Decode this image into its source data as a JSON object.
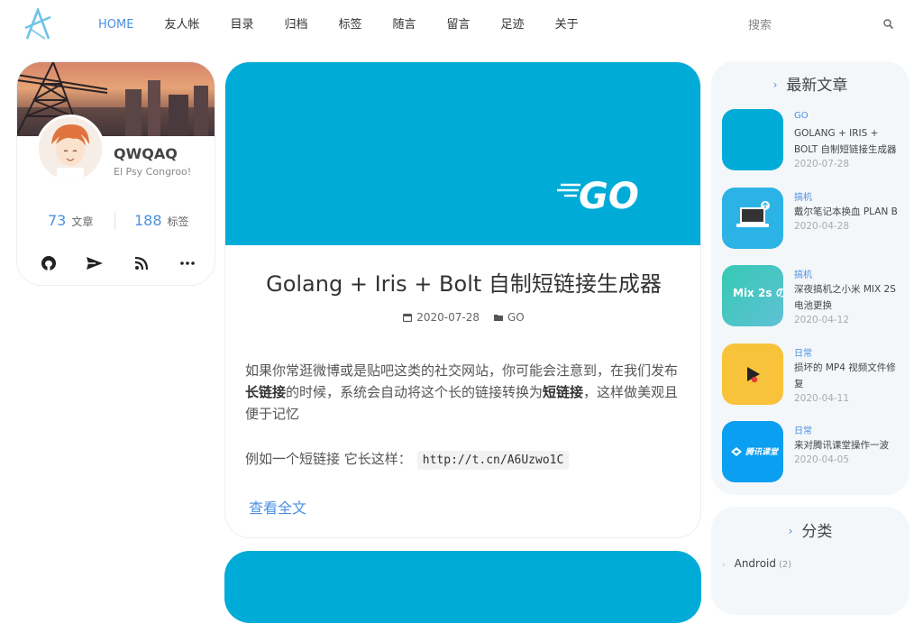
{
  "nav": {
    "items": [
      "HOME",
      "友人帐",
      "目录",
      "归档",
      "标签",
      "随言",
      "留言",
      "足迹",
      "关于"
    ],
    "search_placeholder": "搜索"
  },
  "profile": {
    "name": "QWQAQ",
    "motto": "El Psy Congroo!",
    "posts_count": "73",
    "posts_label": "文章",
    "tags_count": "188",
    "tags_label": "标签"
  },
  "article": {
    "title": "Golang + Iris + Bolt 自制短链接生成器",
    "date": "2020-07-28",
    "category": "GO",
    "cover_logo": "GO",
    "p1_a": "如果你常逛微博或是贴吧这类的社交网站，你可能会注意到，在我们发布",
    "p1_b": "长链接",
    "p1_c": "的时候，系统会自动将这个长的链接转换为",
    "p1_d": "短链接",
    "p1_e": "，这样做美观且便于记忆",
    "p2": "例如一个短链接 它长这样：",
    "code": "http://t.cn/A6Uzwo1C",
    "read_more": "查看全文"
  },
  "recent": {
    "title": "最新文章",
    "items": [
      {
        "cat": "GO",
        "title": "GOLANG + IRIS + BOLT 自制短链接生成器",
        "date": "2020-07-28",
        "color": "#00acd7"
      },
      {
        "cat": "搞机",
        "title": "戴尔笔记本换血 PLAN B",
        "date": "2020-04-28",
        "color": "#2bb3e6"
      },
      {
        "cat": "搞机",
        "title": "深夜搞机之小米 MIX 2S 电池更换",
        "date": "2020-04-12",
        "color": "#3cc6b8"
      },
      {
        "cat": "日常",
        "title": "损坏的 MP4 视频文件修复",
        "date": "2020-04-11",
        "color": "#f8c33a"
      },
      {
        "cat": "日常",
        "title": "来对腾讯课堂操作一波",
        "date": "2020-04-05",
        "color": "#0a9ff0"
      }
    ],
    "thumb3_text": "Mix 2s の",
    "thumb5_text": "腾讯课堂"
  },
  "categories": {
    "title": "分类",
    "items": [
      {
        "name": "Android",
        "count": "(2)"
      }
    ]
  }
}
